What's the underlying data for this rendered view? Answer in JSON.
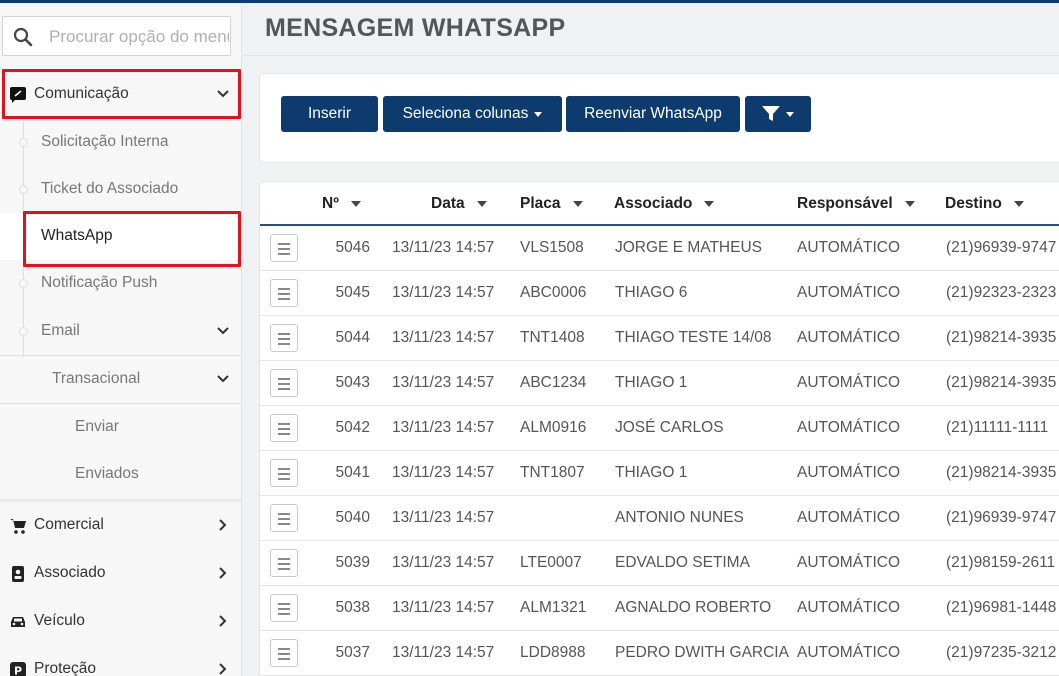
{
  "sidebar": {
    "search": {
      "placeholder": "Procurar opção do menu",
      "icon": "search-icon"
    },
    "groups": [
      {
        "label": "Comunicação",
        "icon": "comment-icon",
        "expanded": true
      },
      {
        "label": "Comercial",
        "icon": "cart-icon"
      },
      {
        "label": "Associado",
        "icon": "id-card-icon"
      },
      {
        "label": "Veículo",
        "icon": "car-icon"
      },
      {
        "label": "Proteção",
        "icon": "parking-icon"
      }
    ],
    "communication_items": [
      {
        "label": "Solicitação Interna"
      },
      {
        "label": "Ticket do Associado"
      },
      {
        "label": "WhatsApp",
        "active": true
      },
      {
        "label": "Notificação Push"
      },
      {
        "label": "Email"
      }
    ],
    "email_items": [
      {
        "label": "Transacional"
      }
    ],
    "transacional_items": [
      {
        "label": "Enviar"
      },
      {
        "label": "Enviados"
      }
    ]
  },
  "page": {
    "title": "MENSAGEM WHATSAPP"
  },
  "toolbar": {
    "insert_label": "Inserir",
    "columns_label": "Seleciona colunas",
    "resend_label": "Reenviar WhatsApp",
    "filter_icon": "filter-icon"
  },
  "table": {
    "columns": [
      "Nº",
      "Data",
      "Placa",
      "Associado",
      "Responsável",
      "Destino"
    ],
    "rows": [
      {
        "num": "5046",
        "data": "13/11/23 14:57",
        "placa": "VLS1508",
        "associado": "JORGE E MATHEUS",
        "responsavel": "AUTOMÁTICO",
        "destino": "(21)96939-9747"
      },
      {
        "num": "5045",
        "data": "13/11/23 14:57",
        "placa": "ABC0006",
        "associado": "THIAGO 6",
        "responsavel": "AUTOMÁTICO",
        "destino": "(21)92323-2323"
      },
      {
        "num": "5044",
        "data": "13/11/23 14:57",
        "placa": "TNT1408",
        "associado": "THIAGO TESTE 14/08",
        "responsavel": "AUTOMÁTICO",
        "destino": "(21)98214-3935"
      },
      {
        "num": "5043",
        "data": "13/11/23 14:57",
        "placa": "ABC1234",
        "associado": "THIAGO 1",
        "responsavel": "AUTOMÁTICO",
        "destino": "(21)98214-3935"
      },
      {
        "num": "5042",
        "data": "13/11/23 14:57",
        "placa": "ALM0916",
        "associado": "JOSÉ CARLOS",
        "responsavel": "AUTOMÁTICO",
        "destino": "(21)11111-1111"
      },
      {
        "num": "5041",
        "data": "13/11/23 14:57",
        "placa": "TNT1807",
        "associado": "THIAGO 1",
        "responsavel": "AUTOMÁTICO",
        "destino": "(21)98214-3935"
      },
      {
        "num": "5040",
        "data": "13/11/23 14:57",
        "placa": "",
        "associado": "ANTONIO NUNES",
        "responsavel": "AUTOMÁTICO",
        "destino": "(21)96939-9747"
      },
      {
        "num": "5039",
        "data": "13/11/23 14:57",
        "placa": "LTE0007",
        "associado": "EDVALDO SETIMA",
        "responsavel": "AUTOMÁTICO",
        "destino": "(21)98159-2611"
      },
      {
        "num": "5038",
        "data": "13/11/23 14:57",
        "placa": "ALM1321",
        "associado": "AGNALDO ROBERTO",
        "responsavel": "AUTOMÁTICO",
        "destino": "(21)96981-1448"
      },
      {
        "num": "5037",
        "data": "13/11/23 14:57",
        "placa": "LDD8988",
        "associado": "PEDRO DWITH GARCIA",
        "responsavel": "AUTOMÁTICO",
        "destino": "(21)97235-3212"
      }
    ]
  },
  "colors": {
    "primary": "#0d3b6e",
    "highlight": "#e0131b"
  }
}
